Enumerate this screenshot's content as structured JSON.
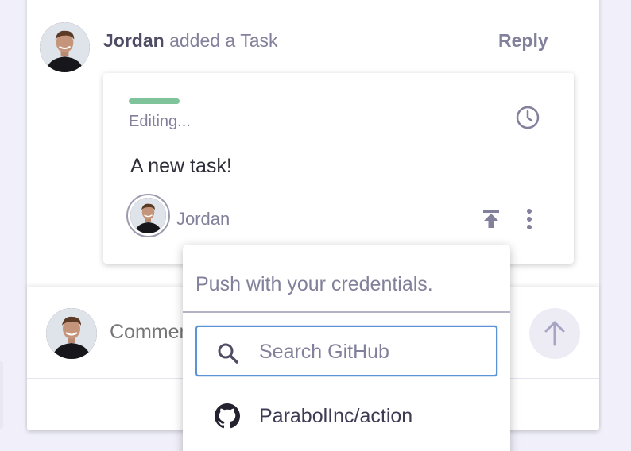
{
  "thread": {
    "author": "Jordan",
    "action_text": "added a Task",
    "reply_label": "Reply"
  },
  "task_card": {
    "status_label": "Editing...",
    "status_color": "#7ec39a",
    "content": "A new task!",
    "assignee": "Jordan"
  },
  "comment_box": {
    "placeholder": "Comment"
  },
  "push_menu": {
    "title": "Push with your credentials.",
    "search_placeholder": "Search GitHub",
    "repos": [
      {
        "label": "ParabolInc/action",
        "icon": "github-icon"
      }
    ]
  },
  "icons": {
    "clock": "clock-icon",
    "push": "push-to-top-icon",
    "more": "more-vertical-icon",
    "send": "arrow-up-icon",
    "search": "search-icon"
  },
  "colors": {
    "focus": "#5a93d6",
    "accent_green": "#7ec39a",
    "muted_text": "#82809a"
  }
}
